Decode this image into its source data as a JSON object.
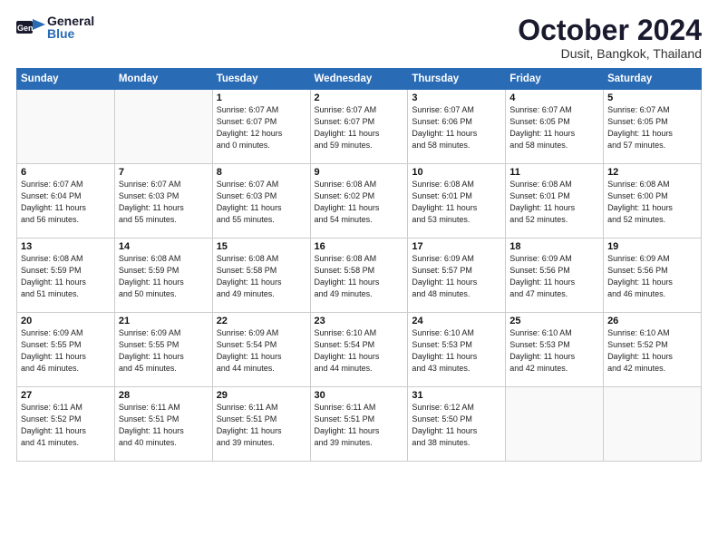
{
  "header": {
    "logo_general": "General",
    "logo_blue": "Blue",
    "month": "October 2024",
    "location": "Dusit, Bangkok, Thailand"
  },
  "days_of_week": [
    "Sunday",
    "Monday",
    "Tuesday",
    "Wednesday",
    "Thursday",
    "Friday",
    "Saturday"
  ],
  "weeks": [
    [
      {
        "day": "",
        "info": ""
      },
      {
        "day": "",
        "info": ""
      },
      {
        "day": "1",
        "info": "Sunrise: 6:07 AM\nSunset: 6:07 PM\nDaylight: 12 hours\nand 0 minutes."
      },
      {
        "day": "2",
        "info": "Sunrise: 6:07 AM\nSunset: 6:07 PM\nDaylight: 11 hours\nand 59 minutes."
      },
      {
        "day": "3",
        "info": "Sunrise: 6:07 AM\nSunset: 6:06 PM\nDaylight: 11 hours\nand 58 minutes."
      },
      {
        "day": "4",
        "info": "Sunrise: 6:07 AM\nSunset: 6:05 PM\nDaylight: 11 hours\nand 58 minutes."
      },
      {
        "day": "5",
        "info": "Sunrise: 6:07 AM\nSunset: 6:05 PM\nDaylight: 11 hours\nand 57 minutes."
      }
    ],
    [
      {
        "day": "6",
        "info": "Sunrise: 6:07 AM\nSunset: 6:04 PM\nDaylight: 11 hours\nand 56 minutes."
      },
      {
        "day": "7",
        "info": "Sunrise: 6:07 AM\nSunset: 6:03 PM\nDaylight: 11 hours\nand 55 minutes."
      },
      {
        "day": "8",
        "info": "Sunrise: 6:07 AM\nSunset: 6:03 PM\nDaylight: 11 hours\nand 55 minutes."
      },
      {
        "day": "9",
        "info": "Sunrise: 6:08 AM\nSunset: 6:02 PM\nDaylight: 11 hours\nand 54 minutes."
      },
      {
        "day": "10",
        "info": "Sunrise: 6:08 AM\nSunset: 6:01 PM\nDaylight: 11 hours\nand 53 minutes."
      },
      {
        "day": "11",
        "info": "Sunrise: 6:08 AM\nSunset: 6:01 PM\nDaylight: 11 hours\nand 52 minutes."
      },
      {
        "day": "12",
        "info": "Sunrise: 6:08 AM\nSunset: 6:00 PM\nDaylight: 11 hours\nand 52 minutes."
      }
    ],
    [
      {
        "day": "13",
        "info": "Sunrise: 6:08 AM\nSunset: 5:59 PM\nDaylight: 11 hours\nand 51 minutes."
      },
      {
        "day": "14",
        "info": "Sunrise: 6:08 AM\nSunset: 5:59 PM\nDaylight: 11 hours\nand 50 minutes."
      },
      {
        "day": "15",
        "info": "Sunrise: 6:08 AM\nSunset: 5:58 PM\nDaylight: 11 hours\nand 49 minutes."
      },
      {
        "day": "16",
        "info": "Sunrise: 6:08 AM\nSunset: 5:58 PM\nDaylight: 11 hours\nand 49 minutes."
      },
      {
        "day": "17",
        "info": "Sunrise: 6:09 AM\nSunset: 5:57 PM\nDaylight: 11 hours\nand 48 minutes."
      },
      {
        "day": "18",
        "info": "Sunrise: 6:09 AM\nSunset: 5:56 PM\nDaylight: 11 hours\nand 47 minutes."
      },
      {
        "day": "19",
        "info": "Sunrise: 6:09 AM\nSunset: 5:56 PM\nDaylight: 11 hours\nand 46 minutes."
      }
    ],
    [
      {
        "day": "20",
        "info": "Sunrise: 6:09 AM\nSunset: 5:55 PM\nDaylight: 11 hours\nand 46 minutes."
      },
      {
        "day": "21",
        "info": "Sunrise: 6:09 AM\nSunset: 5:55 PM\nDaylight: 11 hours\nand 45 minutes."
      },
      {
        "day": "22",
        "info": "Sunrise: 6:09 AM\nSunset: 5:54 PM\nDaylight: 11 hours\nand 44 minutes."
      },
      {
        "day": "23",
        "info": "Sunrise: 6:10 AM\nSunset: 5:54 PM\nDaylight: 11 hours\nand 44 minutes."
      },
      {
        "day": "24",
        "info": "Sunrise: 6:10 AM\nSunset: 5:53 PM\nDaylight: 11 hours\nand 43 minutes."
      },
      {
        "day": "25",
        "info": "Sunrise: 6:10 AM\nSunset: 5:53 PM\nDaylight: 11 hours\nand 42 minutes."
      },
      {
        "day": "26",
        "info": "Sunrise: 6:10 AM\nSunset: 5:52 PM\nDaylight: 11 hours\nand 42 minutes."
      }
    ],
    [
      {
        "day": "27",
        "info": "Sunrise: 6:11 AM\nSunset: 5:52 PM\nDaylight: 11 hours\nand 41 minutes."
      },
      {
        "day": "28",
        "info": "Sunrise: 6:11 AM\nSunset: 5:51 PM\nDaylight: 11 hours\nand 40 minutes."
      },
      {
        "day": "29",
        "info": "Sunrise: 6:11 AM\nSunset: 5:51 PM\nDaylight: 11 hours\nand 39 minutes."
      },
      {
        "day": "30",
        "info": "Sunrise: 6:11 AM\nSunset: 5:51 PM\nDaylight: 11 hours\nand 39 minutes."
      },
      {
        "day": "31",
        "info": "Sunrise: 6:12 AM\nSunset: 5:50 PM\nDaylight: 11 hours\nand 38 minutes."
      },
      {
        "day": "",
        "info": ""
      },
      {
        "day": "",
        "info": ""
      }
    ]
  ]
}
